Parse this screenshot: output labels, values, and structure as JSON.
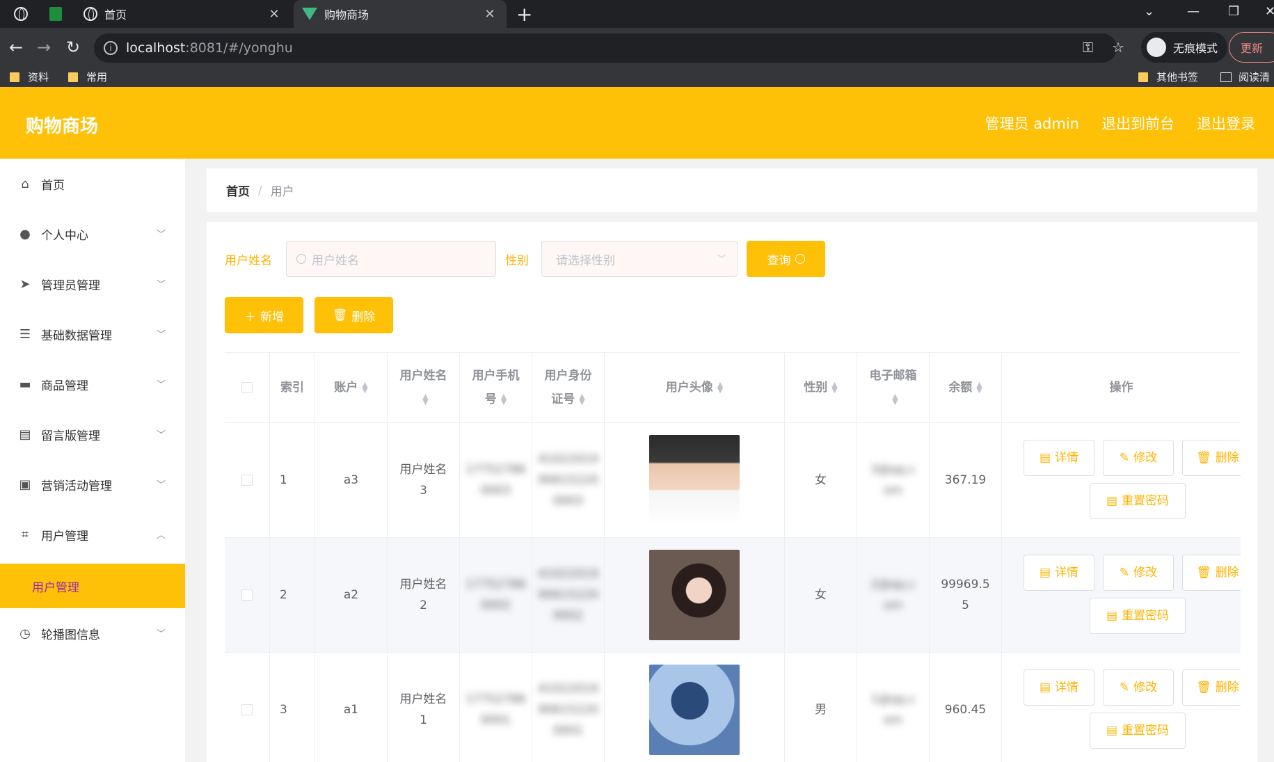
{
  "browser": {
    "tabs": [
      {
        "title": "首页"
      },
      {
        "title": "购物商场"
      }
    ],
    "url_host": "localhost",
    "url_rest": ":8081/#/yonghu",
    "profile_label": "无痕模式",
    "update_label": "更新",
    "bookmarks": [
      "资料",
      "常用"
    ],
    "bookmarks_right": [
      "其他书签",
      "阅读清"
    ]
  },
  "app": {
    "title": "购物商场",
    "header_links": [
      "管理员 admin",
      "退出到前台",
      "退出登录"
    ]
  },
  "sidebar": {
    "items": [
      {
        "label": "首页",
        "icon": "home-icon",
        "glyph": "⌂"
      },
      {
        "label": "个人中心",
        "icon": "user-icon",
        "glyph": "●"
      },
      {
        "label": "管理员管理",
        "icon": "send-icon",
        "glyph": "➤"
      },
      {
        "label": "基础数据管理",
        "icon": "list-icon",
        "glyph": "☰"
      },
      {
        "label": "商品管理",
        "icon": "goods-icon",
        "glyph": "▬"
      },
      {
        "label": "留言版管理",
        "icon": "clipboard-icon",
        "glyph": "▤"
      },
      {
        "label": "营销活动管理",
        "icon": "camera-icon",
        "glyph": "▣"
      },
      {
        "label": "用户管理",
        "icon": "scan-icon",
        "glyph": "⌗"
      },
      {
        "label": "轮播图信息",
        "icon": "compass-icon",
        "glyph": "◷"
      }
    ],
    "active_sub": "用户管理"
  },
  "breadcrumb": {
    "home": "首页",
    "sep": "/",
    "current": "用户"
  },
  "search": {
    "name_label": "用户姓名",
    "name_placeholder": "用户姓名",
    "gender_label": "性别",
    "gender_placeholder": "请选择性别",
    "query_label": "查询"
  },
  "actions": {
    "add_label": "新增",
    "delete_label": "删除"
  },
  "table": {
    "headers": {
      "index": "索引",
      "account": "账户",
      "name": [
        "用户姓",
        "名"
      ],
      "phone": [
        "用户手机",
        "号"
      ],
      "id_card": [
        "用户身份",
        "证号"
      ],
      "avatar": "用户头像",
      "gender": "性别",
      "email": [
        "电子邮箱",
        ""
      ],
      "balance": "余额",
      "ops": "操作"
    },
    "rows": [
      {
        "index": "1",
        "account": "a3",
        "name": [
          "用户姓名",
          "3"
        ],
        "phone": [
          "17752786",
          "0003"
        ],
        "id_card": [
          "41022019",
          "90615220",
          "0003"
        ],
        "gender": "女",
        "email": [
          "3@qq.c",
          "om"
        ],
        "balance": [
          "367.19"
        ]
      },
      {
        "index": "2",
        "account": "a2",
        "name": [
          "用户姓名",
          "2"
        ],
        "phone": [
          "17752786",
          "0002"
        ],
        "id_card": [
          "41022019",
          "90615220",
          "0002"
        ],
        "gender": "女",
        "email": [
          "2@qq.c",
          "om"
        ],
        "balance": [
          "99969.5",
          "5"
        ]
      },
      {
        "index": "3",
        "account": "a1",
        "name": [
          "用户姓名",
          "1"
        ],
        "phone": [
          "17752786",
          "0001"
        ],
        "id_card": [
          "41022019",
          "90615220",
          "0001"
        ],
        "gender": "男",
        "email": [
          "1@qq.c",
          "om"
        ],
        "balance": [
          "960.45"
        ]
      }
    ],
    "op_labels": {
      "detail": "详情",
      "edit": "修改",
      "delete": "删除",
      "reset": "重置密码"
    }
  }
}
